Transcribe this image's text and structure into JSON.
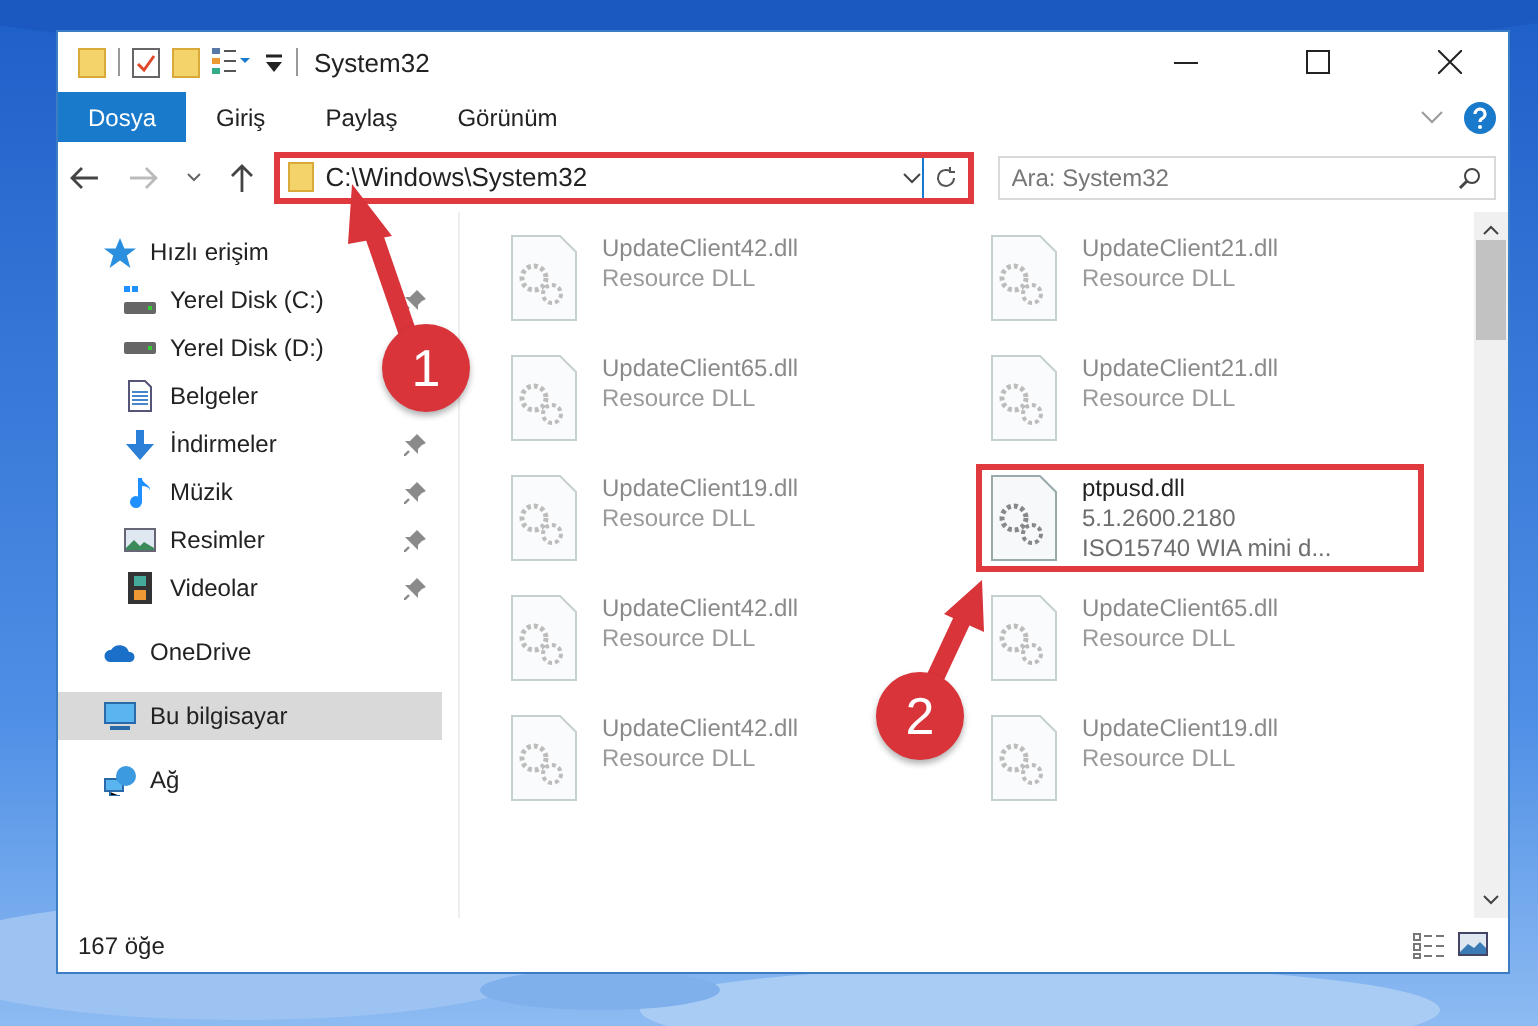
{
  "window": {
    "title": "System32"
  },
  "ribbon": {
    "tabs": [
      {
        "label": "Dosya",
        "selected": true
      },
      {
        "label": "Giriş",
        "selected": false
      },
      {
        "label": "Paylaş",
        "selected": false
      },
      {
        "label": "Görünüm",
        "selected": false
      }
    ]
  },
  "address_bar": {
    "path": "C:\\Windows\\System32",
    "highlighted": true
  },
  "search": {
    "placeholder": "Ara: System32"
  },
  "sidebar": {
    "items": [
      {
        "label": "Hızlı erişim",
        "selected": false,
        "children": [
          {
            "label": "Yerel Disk (C:)",
            "pinned": true,
            "selected": false
          },
          {
            "label": "Yerel Disk (D:)",
            "pinned": false,
            "selected": false
          },
          {
            "label": "Belgeler",
            "pinned": false,
            "selected": false
          },
          {
            "label": "İndirmeler",
            "pinned": true,
            "selected": false
          },
          {
            "label": "Müzik",
            "pinned": true,
            "selected": false
          },
          {
            "label": "Resimler",
            "pinned": true,
            "selected": false
          },
          {
            "label": "Videolar",
            "pinned": true,
            "selected": false
          }
        ]
      },
      {
        "label": "OneDrive",
        "selected": false
      },
      {
        "label": "Bu bilgisayar",
        "selected": true
      },
      {
        "label": "Ağ",
        "selected": false
      }
    ]
  },
  "files": [
    {
      "name": "UpdateClient42.dll",
      "details": [
        "Resource DLL"
      ],
      "dimmed": true,
      "highlighted": false
    },
    {
      "name": "UpdateClient21.dll",
      "details": [
        "Resource DLL"
      ],
      "dimmed": true,
      "highlighted": false
    },
    {
      "name": "UpdateClient65.dll",
      "details": [
        "Resource DLL"
      ],
      "dimmed": true,
      "highlighted": false
    },
    {
      "name": "UpdateClient21.dll",
      "details": [
        "Resource DLL"
      ],
      "dimmed": true,
      "highlighted": false
    },
    {
      "name": "UpdateClient19.dll",
      "details": [
        "Resource DLL"
      ],
      "dimmed": true,
      "highlighted": false
    },
    {
      "name": "ptpusd.dll",
      "details": [
        "5.1.2600.2180",
        "ISO15740 WIA mini d..."
      ],
      "dimmed": false,
      "highlighted": true
    },
    {
      "name": "UpdateClient42.dll",
      "details": [
        "Resource DLL"
      ],
      "dimmed": true,
      "highlighted": false
    },
    {
      "name": "UpdateClient65.dll",
      "details": [
        "Resource DLL"
      ],
      "dimmed": true,
      "highlighted": false
    },
    {
      "name": "UpdateClient42.dll",
      "details": [
        "Resource DLL"
      ],
      "dimmed": true,
      "highlighted": false
    },
    {
      "name": "UpdateClient19.dll",
      "details": [
        "Resource DLL"
      ],
      "dimmed": true,
      "highlighted": false
    }
  ],
  "status_bar": {
    "item_count": "167 öğe"
  },
  "annotations": [
    {
      "label": "1"
    },
    {
      "label": "2"
    }
  ]
}
